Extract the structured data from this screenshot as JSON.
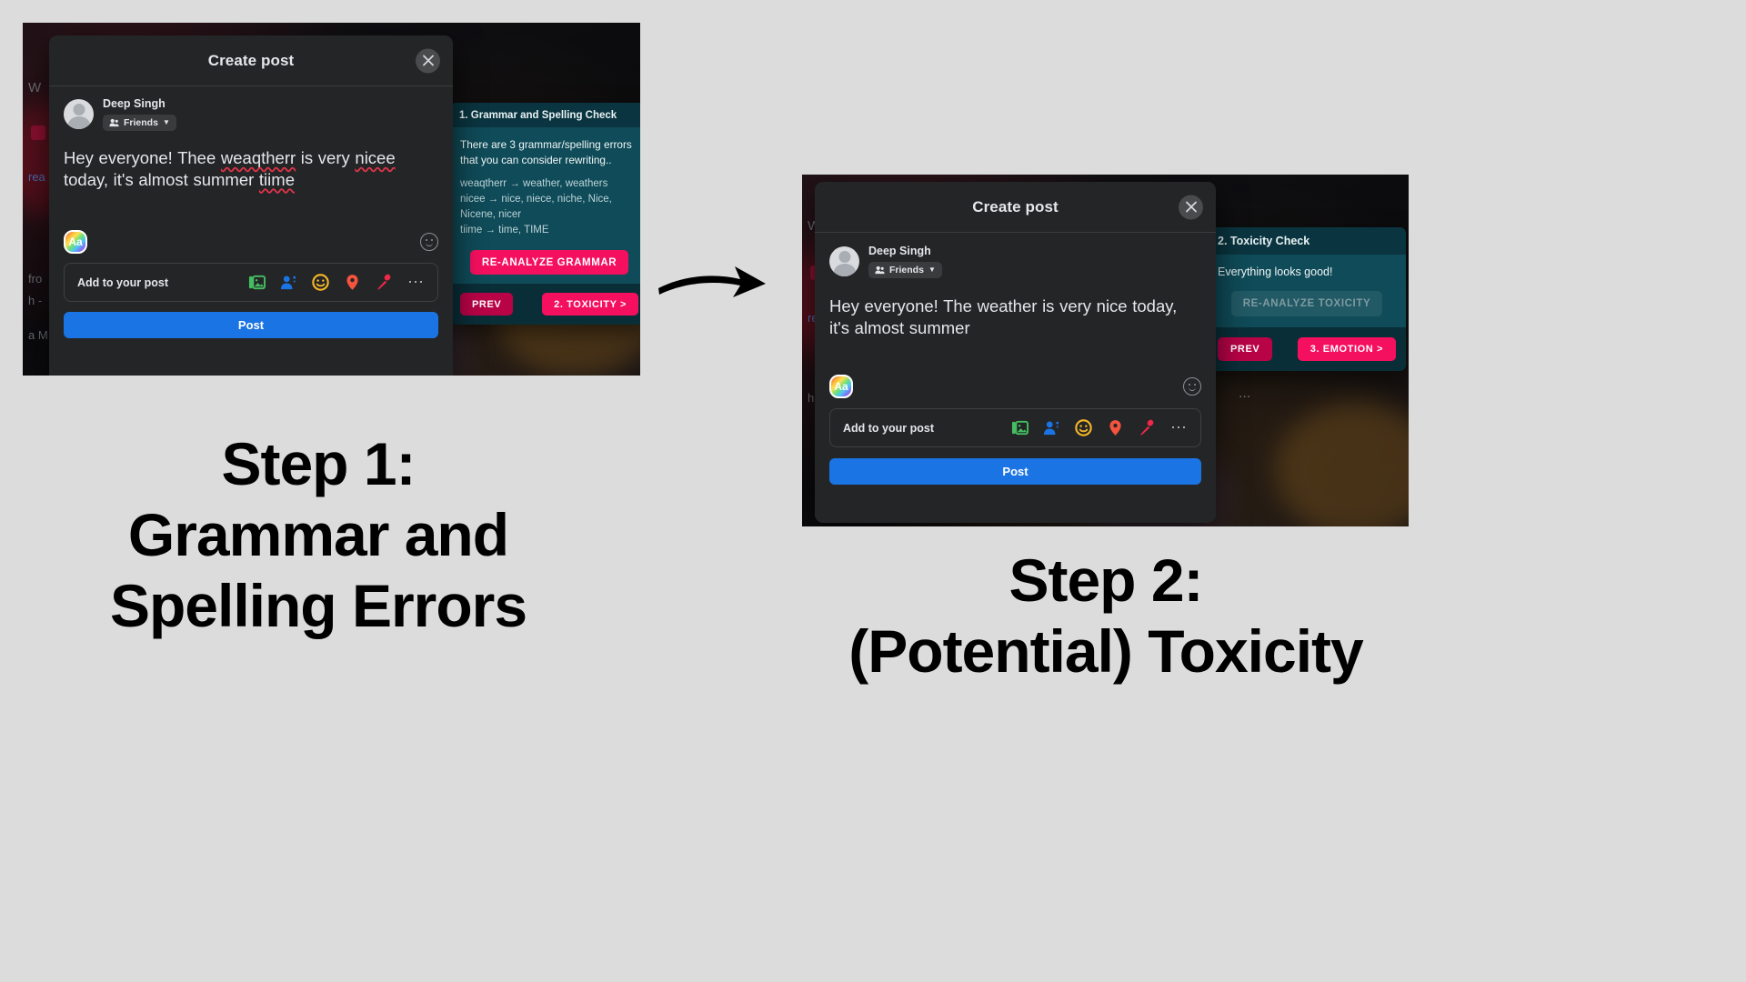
{
  "steps": [
    {
      "caption_line1": "Step 1:",
      "caption_line2": "Grammar and",
      "caption_line3": "Spelling Errors",
      "dialog": {
        "title": "Create post",
        "close_icon": "close-icon",
        "user_name": "Deep Singh",
        "audience_label": "Friends",
        "audience_icon": "friends-icon",
        "caret_icon": "chevron-down-icon",
        "post_text_parts": [
          {
            "text": "Hey everyone! Thee ",
            "misspelled": false
          },
          {
            "text": "weaqtherr",
            "misspelled": true
          },
          {
            "text": " is very ",
            "misspelled": false
          },
          {
            "text": "nicee",
            "misspelled": true
          },
          {
            "text": " today, it's almost summer ",
            "misspelled": false
          },
          {
            "text": "tiime",
            "misspelled": true
          }
        ],
        "post_text_plain": "Hey everyone! Thee weaqtherr is very nicee today, it's almost summer tiime",
        "format_icon_label": "Aa",
        "emoji_icon": "smiley-face-icon",
        "add_row_label": "Add to your post",
        "add_row_icons": [
          "photo-video-icon",
          "tag-people-icon",
          "feeling-activity-icon",
          "check-in-location-icon",
          "live-video-icon",
          "more-options-icon"
        ],
        "post_button_label": "Post"
      },
      "panel": {
        "header": "1. Grammar and Spelling Check",
        "lead": "There are 3 grammar/spelling errors that you can consider rewriting..",
        "suggestions": [
          "weaqtherr → weather, weathers",
          "nicee → nice, niece, niche, Nice, Nicene, nicer",
          "tiime → time, TIME"
        ],
        "reanalyze_label": "RE-ANALYZE GRAMMAR",
        "reanalyze_state": "enabled",
        "prev_label": "PREV",
        "next_label": "2. TOXICITY >"
      }
    },
    {
      "caption_line1": "Step 2:",
      "caption_line2": "(Potential) Toxicity",
      "caption_line3": "",
      "dialog": {
        "title": "Create post",
        "close_icon": "close-icon",
        "user_name": "Deep Singh",
        "audience_label": "Friends",
        "audience_icon": "friends-icon",
        "caret_icon": "chevron-down-icon",
        "post_text_parts": [
          {
            "text": "Hey everyone! The weather is very nice today, it's almost summer",
            "misspelled": false
          }
        ],
        "post_text_plain": "Hey everyone! The weather is very nice today, it's almost summer",
        "format_icon_label": "Aa",
        "emoji_icon": "smiley-face-icon",
        "add_row_label": "Add to your post",
        "add_row_icons": [
          "photo-video-icon",
          "tag-people-icon",
          "feeling-activity-icon",
          "check-in-location-icon",
          "live-video-icon",
          "more-options-icon"
        ],
        "post_button_label": "Post"
      },
      "panel": {
        "header": "2. Toxicity Check",
        "lead": "Everything looks good!",
        "suggestions": [],
        "reanalyze_label": "RE-ANALYZE TOXICITY",
        "reanalyze_state": "disabled",
        "prev_label": "PREV",
        "next_label": "3. EMOTION >"
      }
    }
  ],
  "background_snippets": {
    "s1_a": "W",
    "s1_b": "rea",
    "s1_c": "fro",
    "s1_d": "h -",
    "s1_e": "a M",
    "s2_a": "W",
    "s2_b": "rea",
    "s2_c": "h",
    "s2_d": "..."
  },
  "colors": {
    "page_bg": "#dcdcdc",
    "dialog_bg": "#242526",
    "panel_bg": "#0f4b58",
    "panel_header_bg": "#0a3540",
    "accent_pink": "#f50f5f",
    "accent_crimson": "#b80347",
    "post_blue": "#1b74e4",
    "misspell_underline": "#e0344b"
  }
}
